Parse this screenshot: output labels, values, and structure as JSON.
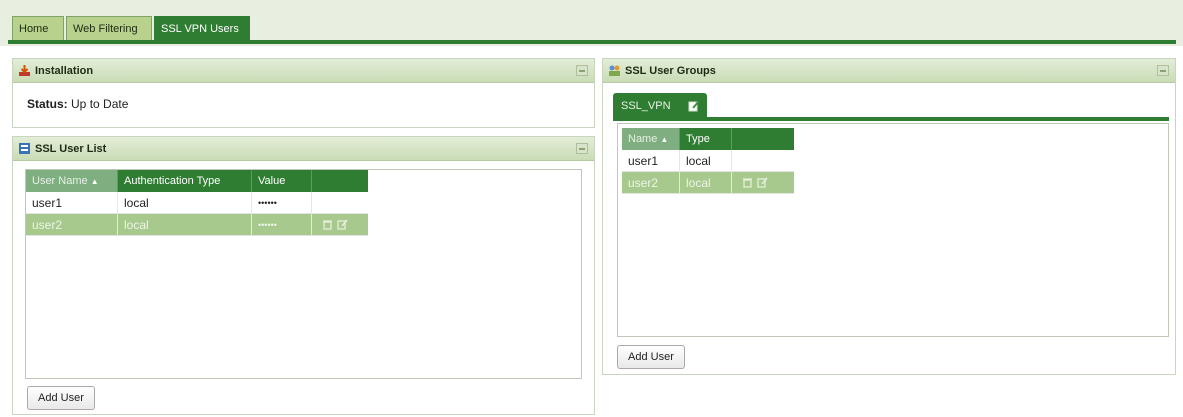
{
  "top_tabs": [
    {
      "label": "Home"
    },
    {
      "label": "Web Filtering"
    },
    {
      "label": "SSL VPN Users"
    }
  ],
  "installation": {
    "title": "Installation",
    "status_label": "Status:",
    "status_value": "Up to Date"
  },
  "user_list": {
    "title": "SSL User List",
    "columns": [
      "User Name",
      "Authentication Type",
      "Value"
    ],
    "rows": [
      {
        "name": "user1",
        "auth": "local",
        "value": "••••••"
      },
      {
        "name": "user2",
        "auth": "local",
        "value": "••••••"
      }
    ],
    "add_button": "Add User"
  },
  "user_groups": {
    "title": "SSL User Groups",
    "group_tab": "SSL_VPN",
    "columns": [
      "Name",
      "Type"
    ],
    "rows": [
      {
        "name": "user1",
        "type": "local"
      },
      {
        "name": "user2",
        "type": "local"
      }
    ],
    "add_button": "Add User"
  },
  "icons": {
    "installation": "install-icon",
    "user_list": "user-list-icon",
    "user_groups": "user-groups-icon",
    "edit_tab": "edit-icon",
    "delete": "trash-icon",
    "edit": "edit-icon",
    "sort": "sort-asc-icon",
    "collapse": "collapse-icon"
  },
  "colors": {
    "accent": "#2f7d32",
    "tab_inactive": "#b8d18c",
    "selected_row": "#a7c98e"
  }
}
